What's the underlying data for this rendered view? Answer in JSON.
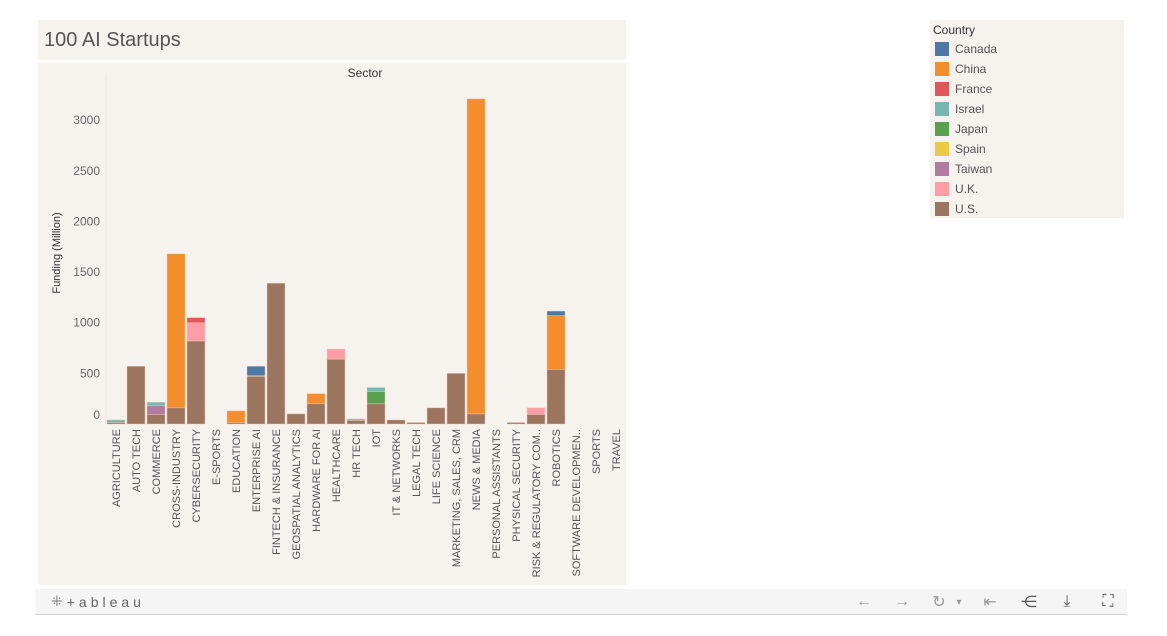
{
  "title": "100 AI Startups",
  "legend": {
    "title": "Country",
    "items": [
      {
        "label": "Canada",
        "color": "#4e79a7"
      },
      {
        "label": "China",
        "color": "#f28e2b"
      },
      {
        "label": "France",
        "color": "#e15759"
      },
      {
        "label": "Israel",
        "color": "#76b7b2"
      },
      {
        "label": "Japan",
        "color": "#59a14f"
      },
      {
        "label": "Spain",
        "color": "#edc948"
      },
      {
        "label": "Taiwan",
        "color": "#b07aa1"
      },
      {
        "label": "U.K.",
        "color": "#ff9da7"
      },
      {
        "label": "U.S.",
        "color": "#9c755f"
      }
    ]
  },
  "toolbar": {
    "logo_text": "+ableau",
    "logo_icon": "tableau-cross-icon",
    "buttons": [
      {
        "name": "undo-button",
        "glyph": "←"
      },
      {
        "name": "redo-button",
        "glyph": "→"
      },
      {
        "name": "revert-button",
        "glyph": "↻"
      },
      {
        "name": "revert-dropdown",
        "glyph": "▾"
      },
      {
        "name": "reset-button",
        "glyph": "⇤"
      },
      {
        "name": "share-button",
        "glyph": "⋲"
      },
      {
        "name": "download-button",
        "glyph": "⤓"
      },
      {
        "name": "fullscreen-button",
        "glyph": "⛶"
      }
    ]
  },
  "chart_data": {
    "type": "bar",
    "stacked": true,
    "title": "100 AI Startups",
    "column_header": "Sector",
    "xlabel": "",
    "ylabel": "Funding (Million)",
    "ylim": [
      0,
      3250
    ],
    "yticks": [
      0,
      500,
      1000,
      1500,
      2000,
      2500,
      3000
    ],
    "grid": false,
    "legend_position": "top-right",
    "categories": [
      "AGRICULTURE",
      "AUTO TECH",
      "COMMERCE",
      "CROSS-INDUSTRY",
      "CYBERSECURITY",
      "E-SPORTS",
      "EDUCATION",
      "ENTERPRISE AI",
      "FINTECH & INSURANCE",
      "GEOSPATIAL ANALYTICS",
      "HARDWARE FOR AI",
      "HEALTHCARE",
      "HR TECH",
      "IOT",
      "IT & NETWORKS",
      "LEGAL TECH",
      "LIFE SCIENCE",
      "MARKETING, SALES, CRM",
      "NEWS & MEDIA",
      "PERSONAL ASSISTANTS",
      "PHYSICAL SECURITY",
      "RISK & REGULATORY COM..",
      "ROBOTICS",
      "SOFTWARE DEVELOPMEN..",
      "SPORTS",
      "TRAVEL"
    ],
    "series": [
      {
        "name": "U.S.",
        "values": [
          15,
          570,
          95,
          160,
          820,
          0,
          15,
          470,
          1390,
          100,
          200,
          640,
          35,
          200,
          40,
          5,
          160,
          500,
          100,
          0,
          5,
          95,
          540,
          0,
          0,
          0
        ]
      },
      {
        "name": "Taiwan",
        "values": [
          0,
          0,
          85,
          0,
          0,
          0,
          0,
          0,
          0,
          0,
          0,
          0,
          0,
          0,
          0,
          0,
          0,
          0,
          0,
          0,
          0,
          0,
          0,
          0,
          0,
          0
        ]
      },
      {
        "name": "U.K.",
        "values": [
          0,
          0,
          0,
          0,
          180,
          0,
          0,
          0,
          0,
          0,
          0,
          100,
          0,
          0,
          0,
          0,
          0,
          0,
          0,
          0,
          0,
          65,
          0,
          0,
          0,
          0
        ]
      },
      {
        "name": "Japan",
        "values": [
          0,
          0,
          0,
          0,
          0,
          0,
          0,
          10,
          0,
          0,
          0,
          0,
          0,
          120,
          0,
          0,
          0,
          0,
          0,
          0,
          0,
          0,
          0,
          0,
          0,
          0
        ]
      },
      {
        "name": "Israel",
        "values": [
          25,
          0,
          35,
          0,
          0,
          0,
          0,
          0,
          0,
          0,
          0,
          0,
          15,
          40,
          0,
          0,
          0,
          0,
          0,
          0,
          0,
          0,
          0,
          0,
          0,
          0
        ]
      },
      {
        "name": "France",
        "values": [
          0,
          0,
          0,
          0,
          50,
          0,
          0,
          0,
          0,
          0,
          0,
          0,
          0,
          0,
          0,
          0,
          0,
          0,
          0,
          0,
          0,
          0,
          0,
          0,
          0,
          0
        ]
      },
      {
        "name": "China",
        "values": [
          0,
          0,
          0,
          1520,
          0,
          0,
          115,
          0,
          0,
          0,
          100,
          0,
          0,
          0,
          0,
          0,
          0,
          0,
          3110,
          0,
          0,
          0,
          530,
          0,
          0,
          0
        ]
      },
      {
        "name": "Canada",
        "values": [
          0,
          0,
          0,
          0,
          0,
          0,
          0,
          90,
          0,
          0,
          0,
          0,
          0,
          0,
          0,
          0,
          0,
          0,
          0,
          0,
          0,
          0,
          45,
          0,
          0,
          0
        ]
      }
    ]
  }
}
